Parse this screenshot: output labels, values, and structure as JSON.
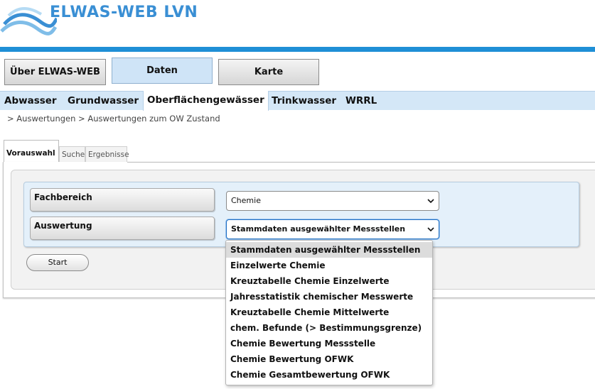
{
  "header": {
    "logo_text": "ELWAS-WEB LVN"
  },
  "main_nav": [
    {
      "label": "Über ELWAS-WEB",
      "active": false
    },
    {
      "label": "Daten",
      "active": true
    },
    {
      "label": "Karte",
      "active": false
    }
  ],
  "sub_nav": [
    {
      "label": "Abwasser"
    },
    {
      "label": "Grundwasser"
    },
    {
      "label": "Oberflächengewässer",
      "active": true
    },
    {
      "label": "Trinkwasser"
    },
    {
      "label": "WRRL"
    }
  ],
  "breadcrumb": "> Auswertungen > Auswertungen zum OW Zustand",
  "tabs": [
    {
      "label": "Vorauswahl",
      "active": true
    },
    {
      "label": "Suche"
    },
    {
      "label": "Ergebnisse"
    }
  ],
  "form": {
    "fachbereich_label": "Fachbereich",
    "fachbereich_value": "Chemie",
    "auswertung_label": "Auswertung",
    "auswertung_value": "Stammdaten ausgewählter Messstellen",
    "start_label": "Start"
  },
  "dropdown_options": [
    "Stammdaten ausgewählter Messstellen",
    "Einzelwerte Chemie",
    "Kreuztabelle Chemie Einzelwerte",
    "Jahresstatistik chemischer Messwerte",
    "Kreuztabelle Chemie Mittelwerte",
    "chem. Befunde (> Bestimmungsgrenze)",
    "Chemie Bewertung Messstelle",
    "Chemie Bewertung OFWK",
    "Chemie Gesamtbewertung OFWK"
  ],
  "colors": {
    "accent": "#1f8fd6",
    "nav_bg": "#d4e7f7",
    "logo": "#3a8fd4"
  },
  "icons": {
    "logo": "wave-logo-icon",
    "chevron": "chevron-down-icon"
  }
}
